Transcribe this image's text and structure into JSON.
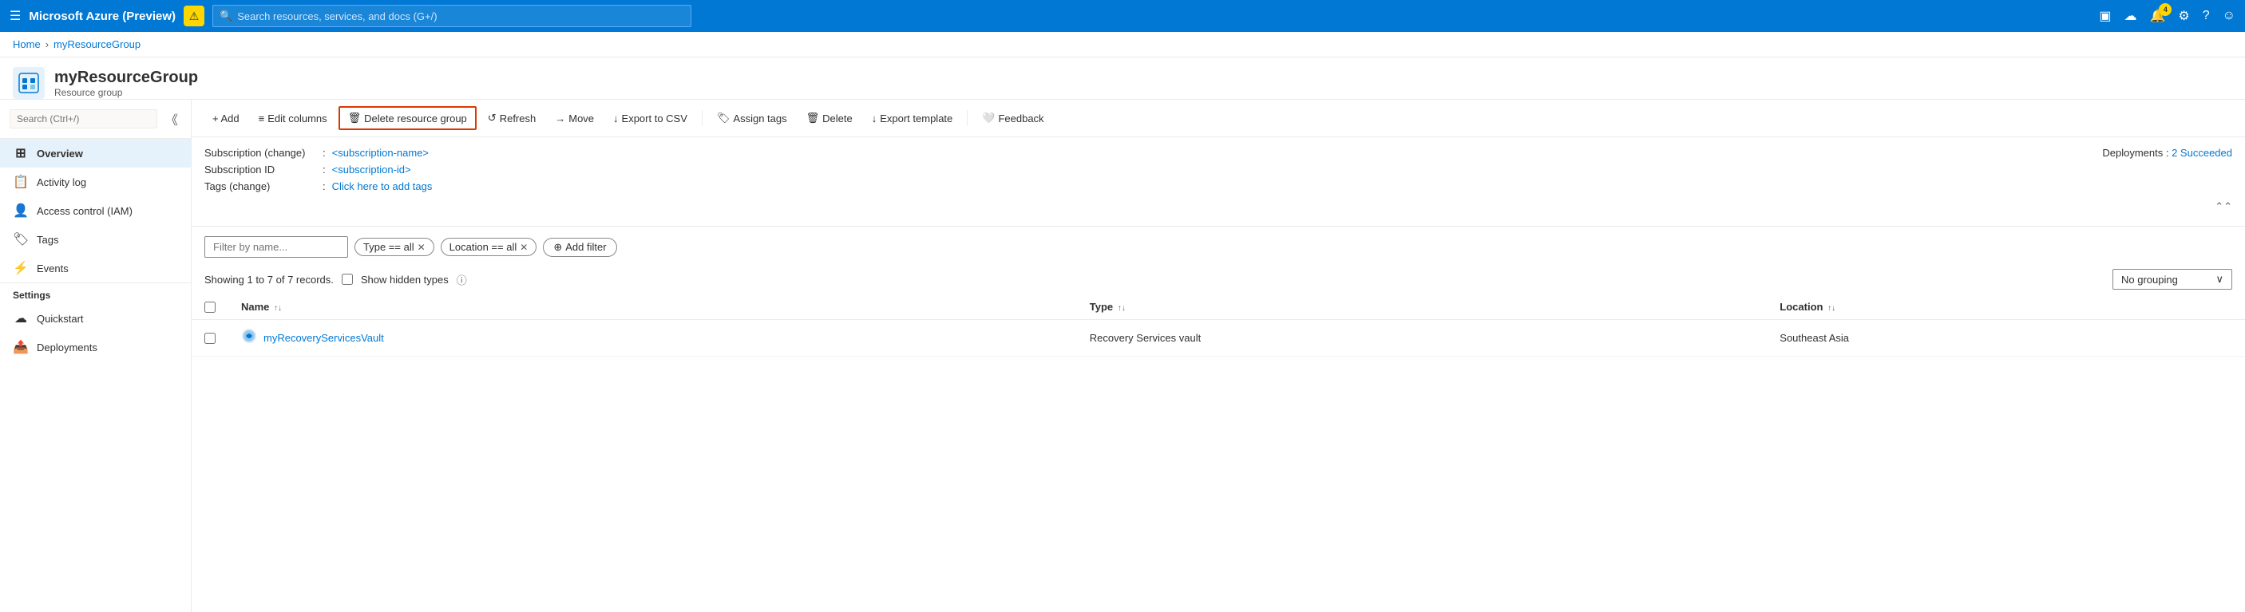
{
  "topnav": {
    "hamburger_icon": "☰",
    "title": "Microsoft Azure (Preview)",
    "warning_icon": "⚠",
    "search_placeholder": "Search resources, services, and docs (G+/)",
    "notification_count": "4",
    "icons": {
      "terminal": "▣",
      "cloud": "☁",
      "bell": "🔔",
      "settings": "⚙",
      "help": "?",
      "smiley": "☺"
    }
  },
  "breadcrumb": {
    "home": "Home",
    "resource_group": "myResourceGroup"
  },
  "page_header": {
    "title": "myResourceGroup",
    "subtitle": "Resource group"
  },
  "toolbar": {
    "add": "+ Add",
    "edit_columns": "Edit columns",
    "delete_resource_group": "Delete resource group",
    "refresh": "Refresh",
    "move": "Move",
    "export_csv": "Export to CSV",
    "assign_tags": "Assign tags",
    "delete": "Delete",
    "export_template": "Export template",
    "feedback": "Feedback"
  },
  "info": {
    "subscription_label": "Subscription (change)",
    "subscription_value": "<subscription-name>",
    "subscription_id_label": "Subscription ID",
    "subscription_id_value": "<subscription-id>",
    "tags_label": "Tags (change)",
    "tags_value": "Click here to add tags",
    "deployments_label": "Deployments :",
    "deployments_value": "2 Succeeded"
  },
  "filter": {
    "placeholder": "Filter by name...",
    "type_filter": "Type == all",
    "location_filter": "Location == all",
    "add_filter": "Add filter"
  },
  "results": {
    "showing": "Showing 1 to 7 of 7 records.",
    "show_hidden": "Show hidden types",
    "grouping": "No grouping"
  },
  "table": {
    "columns": [
      {
        "label": "Name",
        "sort": "↑↓"
      },
      {
        "label": "Type",
        "sort": "↑↓"
      },
      {
        "label": "Location",
        "sort": "↑↓"
      }
    ],
    "rows": [
      {
        "name": "myRecoveryServicesVault",
        "icon": "🔵",
        "type": "Recovery Services vault",
        "location": "Southeast Asia"
      }
    ]
  },
  "sidebar": {
    "search_placeholder": "Search (Ctrl+/)",
    "items": [
      {
        "label": "Overview",
        "icon": "⊞",
        "active": true
      },
      {
        "label": "Activity log",
        "icon": "📋",
        "active": false
      },
      {
        "label": "Access control (IAM)",
        "icon": "👤",
        "active": false
      },
      {
        "label": "Tags",
        "icon": "🏷",
        "active": false
      },
      {
        "label": "Events",
        "icon": "⚡",
        "active": false
      }
    ],
    "sections": [
      {
        "title": "Settings",
        "items": [
          {
            "label": "Quickstart",
            "icon": "☁"
          },
          {
            "label": "Deployments",
            "icon": "📤"
          }
        ]
      }
    ]
  }
}
